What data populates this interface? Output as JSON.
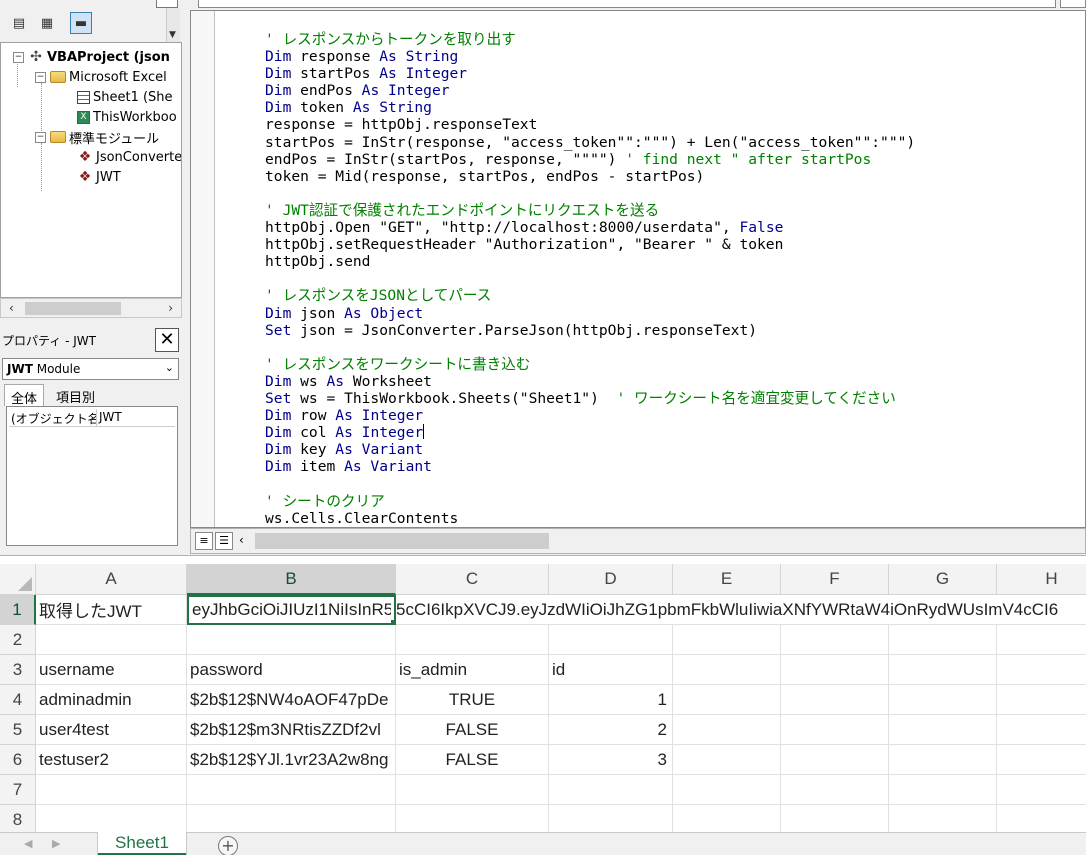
{
  "vbe": {
    "project": {
      "title": "VBAProject (json",
      "excel_objects_folder": "Microsoft Excel",
      "sheet1": "Sheet1 (She",
      "thisworkbook": "ThisWorkboo",
      "modules_folder": "標準モジュール",
      "module1": "JsonConverter",
      "module2": "JWT"
    },
    "properties": {
      "title": "プロパティ - JWT",
      "object_bold": "JWT",
      "object_type": "Module",
      "tab_all": "全体",
      "tab_categorized": "項目別",
      "row_key": "(オブジェクト名",
      "row_value": "JWT"
    },
    "code_lines": [
      [
        {
          "c": "cm",
          "t": "' レスポンスからトークンを取り出す"
        }
      ],
      [
        {
          "c": "kw",
          "t": "Dim"
        },
        {
          "t": " response "
        },
        {
          "c": "kw",
          "t": "As String"
        }
      ],
      [
        {
          "c": "kw",
          "t": "Dim"
        },
        {
          "t": " startPos "
        },
        {
          "c": "kw",
          "t": "As Integer"
        }
      ],
      [
        {
          "c": "kw",
          "t": "Dim"
        },
        {
          "t": " endPos "
        },
        {
          "c": "kw",
          "t": "As Integer"
        }
      ],
      [
        {
          "c": "kw",
          "t": "Dim"
        },
        {
          "t": " token "
        },
        {
          "c": "kw",
          "t": "As String"
        }
      ],
      [
        {
          "t": "response = httpObj.responseText"
        }
      ],
      [
        {
          "t": "startPos = InStr(response, \"access_token\"\":\"\"\") + Len(\"access_token\"\":\"\"\")"
        }
      ],
      [
        {
          "t": "endPos = InStr(startPos, response, \"\"\"\") "
        },
        {
          "c": "cm",
          "t": "' find next \" after startPos"
        }
      ],
      [
        {
          "t": "token = Mid(response, startPos, endPos - startPos)"
        }
      ],
      [],
      [
        {
          "c": "cm",
          "t": "' JWT認証で保護されたエンドポイントにリクエストを送る"
        }
      ],
      [
        {
          "t": "httpObj.Open \"GET\", \"http://localhost:8000/userdata\", "
        },
        {
          "c": "kw",
          "t": "False"
        }
      ],
      [
        {
          "t": "httpObj.setRequestHeader \"Authorization\", \"Bearer \" & token"
        }
      ],
      [
        {
          "t": "httpObj.send"
        }
      ],
      [],
      [
        {
          "c": "cm",
          "t": "' レスポンスをJSONとしてパース"
        }
      ],
      [
        {
          "c": "kw",
          "t": "Dim"
        },
        {
          "t": " json "
        },
        {
          "c": "kw",
          "t": "As Object"
        }
      ],
      [
        {
          "c": "kw",
          "t": "Set"
        },
        {
          "t": " json = JsonConverter.ParseJson(httpObj.responseText)"
        }
      ],
      [],
      [
        {
          "c": "cm",
          "t": "' レスポンスをワークシートに書き込む"
        }
      ],
      [
        {
          "c": "kw",
          "t": "Dim"
        },
        {
          "t": " ws "
        },
        {
          "c": "kw",
          "t": "As"
        },
        {
          "t": " Worksheet"
        }
      ],
      [
        {
          "c": "kw",
          "t": "Set"
        },
        {
          "t": " ws = ThisWorkbook.Sheets(\"Sheet1\")  "
        },
        {
          "c": "cm",
          "t": "' ワークシート名を適宜変更してください"
        }
      ],
      [
        {
          "c": "kw",
          "t": "Dim"
        },
        {
          "t": " row "
        },
        {
          "c": "kw",
          "t": "As Integer"
        }
      ],
      [
        {
          "c": "kw",
          "t": "Dim"
        },
        {
          "t": " col "
        },
        {
          "c": "kw",
          "t": "As Integer"
        },
        {
          "c": "cursor",
          "t": ""
        }
      ],
      [
        {
          "c": "kw",
          "t": "Dim"
        },
        {
          "t": " key "
        },
        {
          "c": "kw",
          "t": "As Variant"
        }
      ],
      [
        {
          "c": "kw",
          "t": "Dim"
        },
        {
          "t": " item "
        },
        {
          "c": "kw",
          "t": "As Variant"
        }
      ],
      [],
      [
        {
          "c": "cm",
          "t": "' シートのクリア"
        }
      ],
      [
        {
          "t": "ws.Cells.ClearContents"
        }
      ]
    ]
  },
  "sheet": {
    "columns": [
      "A",
      "B",
      "C",
      "D",
      "E",
      "F",
      "G",
      "H"
    ],
    "rows": [
      "1",
      "2",
      "3",
      "4",
      "5",
      "6",
      "7",
      "8"
    ],
    "selected_column": "B",
    "selected_row": "1",
    "a1": "取得したJWT",
    "b1": "eyJhbGciOiJIUzI1NiIsInR5cCI6IkpXVCJ9.eyJzdWIiOiJhZG1pbmFkbWluIiwiaXNfYWRtaW4iOnRydWUsImV4cCI6",
    "headers": [
      "username",
      "password",
      "is_admin",
      "id"
    ],
    "records": [
      [
        "adminadmin",
        "$2b$12$NW4oAOF47pDe",
        "TRUE",
        "1"
      ],
      [
        "user4test",
        "$2b$12$m3NRtisZZDf2vl",
        "FALSE",
        "2"
      ],
      [
        "testuser2",
        "$2b$12$YJl.1vr23A2w8ng",
        "FALSE",
        "3"
      ]
    ],
    "tab_name": "Sheet1",
    "add_sheet": "+"
  }
}
